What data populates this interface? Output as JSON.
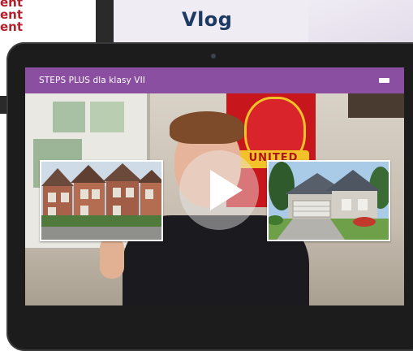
{
  "page": {
    "title": "Vlog",
    "left_text": [
      "ent",
      "ent",
      "ent"
    ]
  },
  "player": {
    "header_title": "STEPS PLUS  dla klasy VII",
    "menu_icon": "menu-icon",
    "play_icon": "play-icon",
    "flag_text": "UNITED"
  },
  "colors": {
    "header_bg": "#8b4fa2",
    "title": "#1d3a63",
    "accent_red": "#b3202b"
  }
}
